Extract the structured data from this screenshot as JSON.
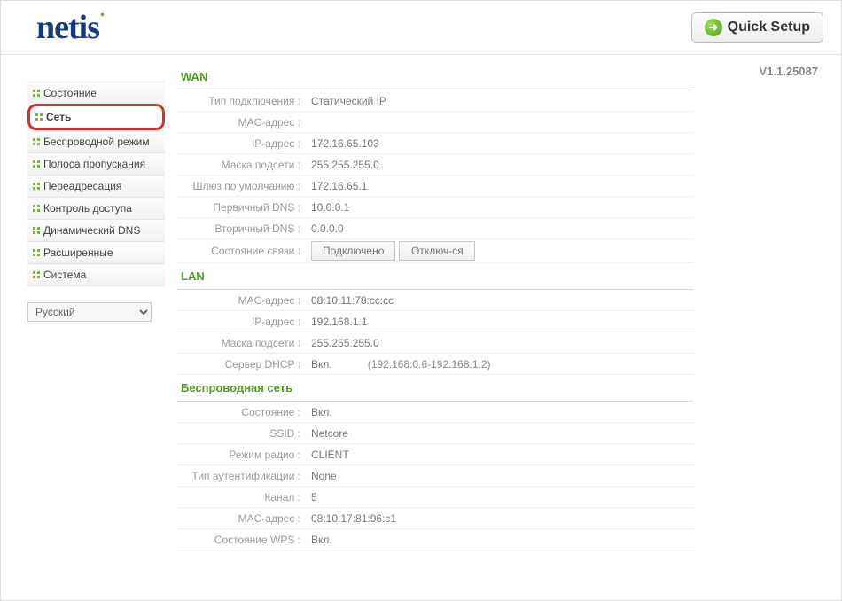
{
  "header": {
    "logo_text": "netis",
    "quick_setup_label": "Quick Setup"
  },
  "version": "V1.1.25087",
  "sidebar": {
    "items": [
      {
        "label": "Состояние"
      },
      {
        "label": "Сеть"
      },
      {
        "label": "Беспроводной режим"
      },
      {
        "label": "Полоса пропускания"
      },
      {
        "label": "Переадресация"
      },
      {
        "label": "Контроль доступа"
      },
      {
        "label": "Динамический DNS"
      },
      {
        "label": "Расширенные"
      },
      {
        "label": "Система"
      }
    ],
    "language_selected": "Русский"
  },
  "wan": {
    "title": "WAN",
    "conn_type_label": "Тип подключения :",
    "conn_type_value": "Статический IP",
    "mac_label": "MAC-адрес :",
    "mac_value": "",
    "ip_label": "IP-адрес :",
    "ip_value": "172.16.65.103",
    "mask_label": "Маска подсети :",
    "mask_value": "255.255.255.0",
    "gw_label": "Шлюз по умолчанию :",
    "gw_value": "172.16.65.1",
    "dns1_label": "Первичный DNS :",
    "dns1_value": "10.0.0.1",
    "dns2_label": "Вторичный DNS :",
    "dns2_value": "0.0.0.0",
    "link_label": "Состояние связи :",
    "btn_connected": "Подключено",
    "btn_disconnect": "Отключ-ся"
  },
  "lan": {
    "title": "LAN",
    "mac_label": "MAC-адрес :",
    "mac_value": "08:10:11:78:cc:cc",
    "ip_label": "IP-адрес :",
    "ip_value": "192.168.1.1",
    "mask_label": "Маска подсети :",
    "mask_value": "255.255.255.0",
    "dhcp_label": "Сервер DHCP :",
    "dhcp_value": "Вкл.",
    "dhcp_range": "(192.168.0.6-192.168.1.2)"
  },
  "wlan": {
    "title": "Беспроводная сеть",
    "state_label": "Состояние :",
    "state_value": "Вкл.",
    "ssid_label": "SSID :",
    "ssid_value": "Netcore",
    "radio_label": "Режим радио :",
    "radio_value": "CLIENT",
    "auth_label": "Тип аутентификации :",
    "auth_value": "None",
    "chan_label": "Канал :",
    "chan_value": "5",
    "mac_label": "MAC-адрес :",
    "mac_value": "08:10:17:81:96:c1",
    "wps_label": "Состояние WPS :",
    "wps_value": "Вкл."
  }
}
